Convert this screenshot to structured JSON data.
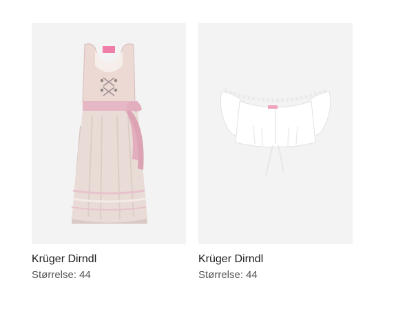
{
  "products": [
    {
      "title": "Krüger Dirndl",
      "size": "Størrelse: 44",
      "image": "pink-dirndl-dress"
    },
    {
      "title": "Krüger Dirndl",
      "size": "Størrelse: 44",
      "image": "white-dirndl-blouse"
    }
  ],
  "colors": {
    "card_background": "#f3f3f3",
    "title_text": "#1a1a1a",
    "size_text": "#555555",
    "dress_pink": "#e6b7c4",
    "dress_beige": "#e9dcd6"
  }
}
